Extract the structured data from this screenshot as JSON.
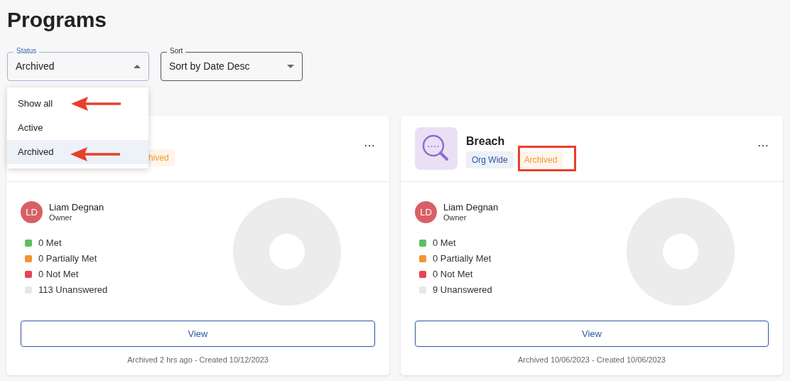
{
  "page_title": "Programs",
  "filters": [
    {
      "label": "Status",
      "value": "Archived",
      "open": true
    },
    {
      "label": "Sort",
      "value": "Sort by Date Desc",
      "open": false
    }
  ],
  "status_menu": [
    {
      "label": "Show all",
      "selected": false
    },
    {
      "label": "Active",
      "selected": false
    },
    {
      "label": "Archived",
      "selected": true
    }
  ],
  "programs": [
    {
      "tags": [
        {
          "text": "hived",
          "kind": "status"
        }
      ],
      "more": "⋯",
      "owner": {
        "initials": "LD",
        "name": "Liam Degnan",
        "role": "Owner"
      },
      "legend": [
        {
          "text": "0 Met",
          "color": "#5cc060"
        },
        {
          "text": "0 Partially Met",
          "color": "#f39436"
        },
        {
          "text": "0 Not Met",
          "color": "#e84358"
        },
        {
          "text": "113 Unanswered",
          "color": "#e8e8e8"
        }
      ],
      "button": "View",
      "footer": "Archived 2 hrs ago - Created 10/12/2023"
    },
    {
      "title": "Breach",
      "tags": [
        {
          "text": "Org Wide",
          "kind": "scope"
        },
        {
          "text": "Archived",
          "kind": "status"
        }
      ],
      "more": "⋯",
      "owner": {
        "initials": "LD",
        "name": "Liam Degnan",
        "role": "Owner"
      },
      "legend": [
        {
          "text": "0 Met",
          "color": "#5cc060"
        },
        {
          "text": "0 Partially Met",
          "color": "#f39436"
        },
        {
          "text": "0 Not Met",
          "color": "#e84358"
        },
        {
          "text": "9 Unanswered",
          "color": "#e8e8e8"
        }
      ],
      "button": "View",
      "footer": "Archived 10/06/2023 - Created 10/06/2023"
    }
  ]
}
